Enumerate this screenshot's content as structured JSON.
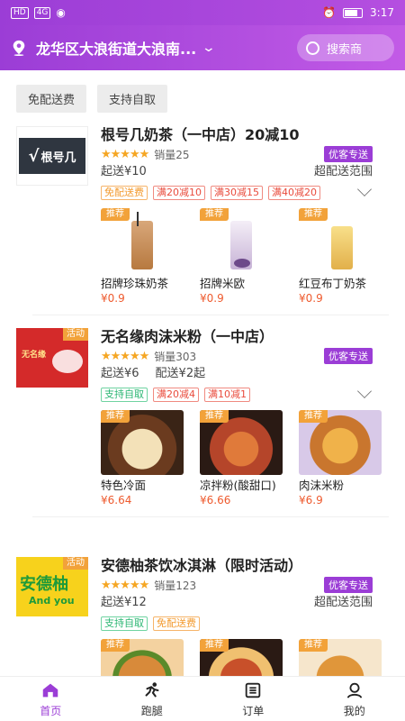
{
  "status_bar": {
    "left": [
      "HD",
      "4G"
    ],
    "time": "3:17"
  },
  "header": {
    "location": "龙华区大浪街道大浪南...",
    "search_label": "搜索商"
  },
  "filters": [
    "免配送费",
    "支持自取"
  ],
  "stores": [
    {
      "name": "根号几奶茶（一中店）20减10",
      "logo_text": "根号几",
      "sales": "销量25",
      "badge": "优客专送",
      "min_order": "起送¥10",
      "delivery": "",
      "range": "超配送范围",
      "tags": [
        {
          "text": "免配送费",
          "kind": "orange"
        },
        {
          "text": "满20减10",
          "kind": "red"
        },
        {
          "text": "满30减15",
          "kind": "red"
        },
        {
          "text": "满40减20",
          "kind": "red"
        }
      ],
      "products": [
        {
          "name": "招牌珍珠奶茶",
          "price": "¥0.9",
          "badge": "推荐"
        },
        {
          "name": "招牌米欧",
          "price": "¥0.9",
          "badge": "推荐"
        },
        {
          "name": "红豆布丁奶茶",
          "price": "¥0.9",
          "badge": "推荐"
        }
      ]
    },
    {
      "name": "无名缘肉沫米粉（一中店）",
      "logo_text": "活动",
      "sales": "销量303",
      "badge": "优客专送",
      "min_order": "起送¥6",
      "delivery": "配送¥2起",
      "range": "",
      "tags": [
        {
          "text": "支持自取",
          "kind": "green"
        },
        {
          "text": "满20减4",
          "kind": "red"
        },
        {
          "text": "满10减1",
          "kind": "red"
        }
      ],
      "products": [
        {
          "name": "特色冷面",
          "price": "¥6.64",
          "badge": "推荐"
        },
        {
          "name": "凉拌粉(酸甜口)",
          "price": "¥6.66",
          "badge": "推荐"
        },
        {
          "name": "肉沫米粉",
          "price": "¥6.9",
          "badge": "推荐"
        }
      ]
    },
    {
      "name": "安德柚茶饮冰淇淋（限时活动）",
      "logo_text": "安德柚",
      "logo_sub": "And you",
      "logo_badge": "活动",
      "sales": "销量123",
      "badge": "优客专送",
      "min_order": "起送¥12",
      "delivery": "",
      "range": "超配送范围",
      "tags": [
        {
          "text": "支持自取",
          "kind": "green"
        },
        {
          "text": "免配送费",
          "kind": "orange"
        }
      ],
      "products": [
        {
          "name": "",
          "price": "",
          "badge": "推荐"
        },
        {
          "name": "",
          "price": "",
          "badge": "推荐"
        },
        {
          "name": "",
          "price": "",
          "badge": "推荐"
        }
      ]
    }
  ],
  "tabbar": [
    {
      "label": "首页",
      "icon": "home-icon",
      "active": true
    },
    {
      "label": "跑腿",
      "icon": "runner-icon",
      "active": false
    },
    {
      "label": "订单",
      "icon": "order-icon",
      "active": false
    },
    {
      "label": "我的",
      "icon": "profile-icon",
      "active": false
    }
  ],
  "colors": {
    "brand": "#9b3dd6",
    "accent_orange": "#f2a23a",
    "price": "#ee5a2e"
  }
}
